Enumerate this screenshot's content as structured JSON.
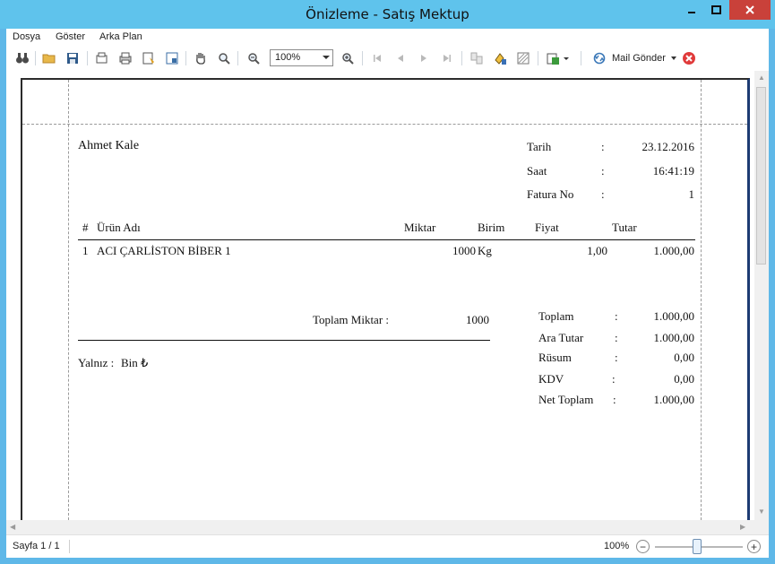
{
  "window": {
    "title": "Önizleme - Satış Mektup"
  },
  "menu": [
    "Dosya",
    "Göster",
    "Arka Plan"
  ],
  "toolbar": {
    "zoom_value": "100%",
    "mail_label": "Mail Gönder",
    "icons": [
      "binoculars-icon",
      "open-folder-icon",
      "save-icon",
      "page-setup-icon",
      "print-icon",
      "quick-print-icon",
      "page-layout-icon",
      "hand-tool-icon",
      "magnifier-icon",
      "zoom-out-icon",
      "zoom-in-icon",
      "first-page-icon",
      "previous-page-icon",
      "next-page-icon",
      "last-page-icon",
      "multiple-pages-icon",
      "page-color-icon",
      "watermark-icon",
      "export-icon",
      "mail-icon",
      "close-preview-icon"
    ]
  },
  "document": {
    "customer": "Ahmet Kale",
    "info": [
      {
        "label": "Tarih",
        "sep": ":",
        "value": "23.12.2016"
      },
      {
        "label": "Saat",
        "sep": ":",
        "value": "16:41:19"
      },
      {
        "label": "Fatura No",
        "sep": ":",
        "value": "1"
      }
    ],
    "table": {
      "headers": {
        "no": "#",
        "product": "Ürün Adı",
        "qty": "Miktar",
        "unit": "Birim",
        "price": "Fiyat",
        "total": "Tutar"
      },
      "rows": [
        {
          "no": "1",
          "product": "ACI ÇARLİSTON BİBER 1",
          "qty": "1000",
          "unit": "Kg",
          "price": "1,00",
          "total": "1.000,00"
        }
      ]
    },
    "total_qty_label": "Toplam Miktar :",
    "total_qty_value": "1000",
    "in_words_label": "Yalnız :",
    "in_words_value": "Bin ₺",
    "totals": [
      {
        "label": "Toplam",
        "sep": ":",
        "value": "1.000,00"
      },
      {
        "label": "Ara Tutar",
        "sep": ":",
        "value": "1.000,00"
      },
      {
        "label": "Rüsum",
        "sep": ":",
        "value": "0,00"
      },
      {
        "label": "KDV",
        "sep": ":",
        "value": "0,00"
      },
      {
        "label": "Net Toplam",
        "sep": ":",
        "value": "1.000,00"
      }
    ]
  },
  "status": {
    "page": "Sayfa 1 / 1",
    "zoom": "100%",
    "zoom_level_percent": 100
  },
  "colors": {
    "title_bar": "#5fc3ec",
    "close_button": "#c9413a",
    "page_border_right": "#1d3b73"
  }
}
